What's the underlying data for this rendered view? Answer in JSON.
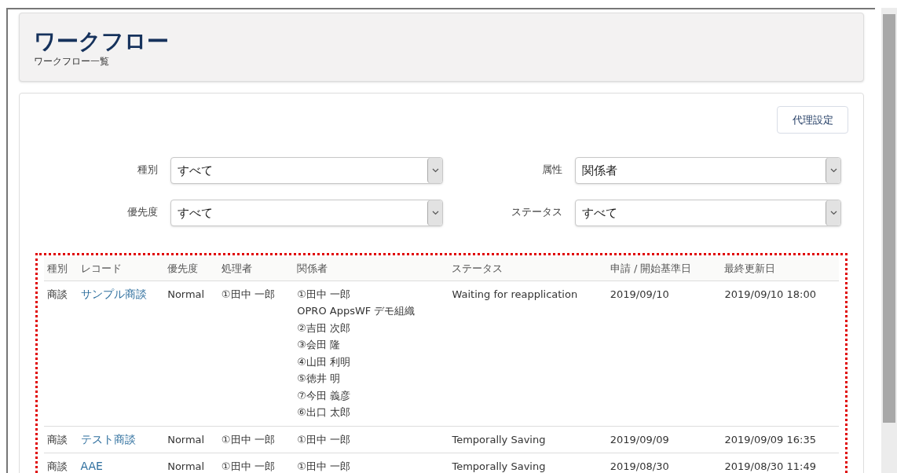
{
  "header": {
    "title": "ワークフロー",
    "subtitle": "ワークフロー一覧"
  },
  "proxy_button": "代理設定",
  "filters": [
    {
      "label": "種別",
      "value": "すべて"
    },
    {
      "label": "属性",
      "value": "関係者"
    },
    {
      "label": "優先度",
      "value": "すべて"
    },
    {
      "label": "ステータス",
      "value": "すべて"
    }
  ],
  "table": {
    "columns": [
      "種別",
      "レコード",
      "優先度",
      "処理者",
      "関係者",
      "ステータス",
      "申請 / 開始基準日",
      "最終更新日"
    ],
    "rows": [
      {
        "type": "商談",
        "record": "サンプル商談",
        "priority": "Normal",
        "handler": "①田中 一郎",
        "related": [
          "①田中 一郎",
          "OPRO AppsWF デモ組織",
          "②吉田 次郎",
          "③会田 隆",
          "④山田 利明",
          "⑤徳井 明",
          "⑦今田 義彦",
          "⑥出口 太郎"
        ],
        "status": "Waiting for reapplication",
        "start_date": "2019/09/10",
        "updated": "2019/09/10 18:00"
      },
      {
        "type": "商談",
        "record": "テスト商談",
        "priority": "Normal",
        "handler": "①田中 一郎",
        "related": [
          "①田中 一郎"
        ],
        "status": "Temporally Saving",
        "start_date": "2019/09/09",
        "updated": "2019/09/09 16:35"
      },
      {
        "type": "商談",
        "record": "AAE",
        "priority": "Normal",
        "handler": "①田中 一郎",
        "related": [
          "①田中 一郎"
        ],
        "status": "Temporally Saving",
        "start_date": "2019/08/30",
        "updated": "2019/08/30 11:49"
      }
    ]
  }
}
